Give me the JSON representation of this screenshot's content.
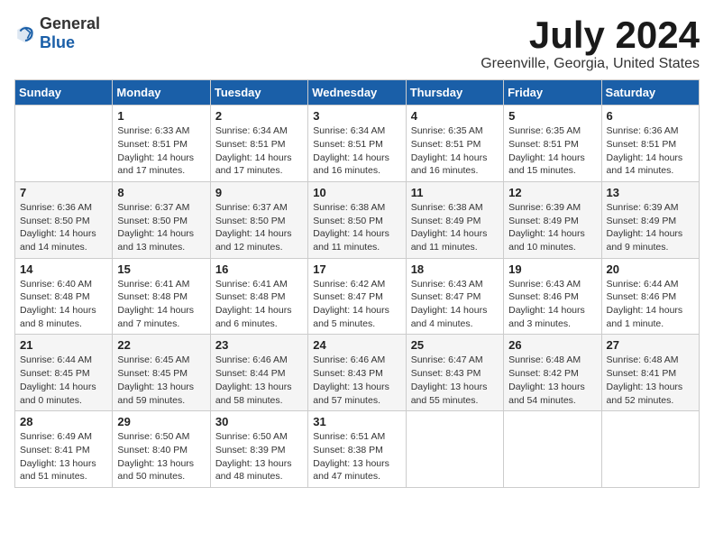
{
  "header": {
    "logo_general": "General",
    "logo_blue": "Blue",
    "month_title": "July 2024",
    "location": "Greenville, Georgia, United States"
  },
  "weekdays": [
    "Sunday",
    "Monday",
    "Tuesday",
    "Wednesday",
    "Thursday",
    "Friday",
    "Saturday"
  ],
  "weeks": [
    [
      {
        "day": "",
        "info": ""
      },
      {
        "day": "1",
        "info": "Sunrise: 6:33 AM\nSunset: 8:51 PM\nDaylight: 14 hours\nand 17 minutes."
      },
      {
        "day": "2",
        "info": "Sunrise: 6:34 AM\nSunset: 8:51 PM\nDaylight: 14 hours\nand 17 minutes."
      },
      {
        "day": "3",
        "info": "Sunrise: 6:34 AM\nSunset: 8:51 PM\nDaylight: 14 hours\nand 16 minutes."
      },
      {
        "day": "4",
        "info": "Sunrise: 6:35 AM\nSunset: 8:51 PM\nDaylight: 14 hours\nand 16 minutes."
      },
      {
        "day": "5",
        "info": "Sunrise: 6:35 AM\nSunset: 8:51 PM\nDaylight: 14 hours\nand 15 minutes."
      },
      {
        "day": "6",
        "info": "Sunrise: 6:36 AM\nSunset: 8:51 PM\nDaylight: 14 hours\nand 14 minutes."
      }
    ],
    [
      {
        "day": "7",
        "info": "Sunrise: 6:36 AM\nSunset: 8:50 PM\nDaylight: 14 hours\nand 14 minutes."
      },
      {
        "day": "8",
        "info": "Sunrise: 6:37 AM\nSunset: 8:50 PM\nDaylight: 14 hours\nand 13 minutes."
      },
      {
        "day": "9",
        "info": "Sunrise: 6:37 AM\nSunset: 8:50 PM\nDaylight: 14 hours\nand 12 minutes."
      },
      {
        "day": "10",
        "info": "Sunrise: 6:38 AM\nSunset: 8:50 PM\nDaylight: 14 hours\nand 11 minutes."
      },
      {
        "day": "11",
        "info": "Sunrise: 6:38 AM\nSunset: 8:49 PM\nDaylight: 14 hours\nand 11 minutes."
      },
      {
        "day": "12",
        "info": "Sunrise: 6:39 AM\nSunset: 8:49 PM\nDaylight: 14 hours\nand 10 minutes."
      },
      {
        "day": "13",
        "info": "Sunrise: 6:39 AM\nSunset: 8:49 PM\nDaylight: 14 hours\nand 9 minutes."
      }
    ],
    [
      {
        "day": "14",
        "info": "Sunrise: 6:40 AM\nSunset: 8:48 PM\nDaylight: 14 hours\nand 8 minutes."
      },
      {
        "day": "15",
        "info": "Sunrise: 6:41 AM\nSunset: 8:48 PM\nDaylight: 14 hours\nand 7 minutes."
      },
      {
        "day": "16",
        "info": "Sunrise: 6:41 AM\nSunset: 8:48 PM\nDaylight: 14 hours\nand 6 minutes."
      },
      {
        "day": "17",
        "info": "Sunrise: 6:42 AM\nSunset: 8:47 PM\nDaylight: 14 hours\nand 5 minutes."
      },
      {
        "day": "18",
        "info": "Sunrise: 6:43 AM\nSunset: 8:47 PM\nDaylight: 14 hours\nand 4 minutes."
      },
      {
        "day": "19",
        "info": "Sunrise: 6:43 AM\nSunset: 8:46 PM\nDaylight: 14 hours\nand 3 minutes."
      },
      {
        "day": "20",
        "info": "Sunrise: 6:44 AM\nSunset: 8:46 PM\nDaylight: 14 hours\nand 1 minute."
      }
    ],
    [
      {
        "day": "21",
        "info": "Sunrise: 6:44 AM\nSunset: 8:45 PM\nDaylight: 14 hours\nand 0 minutes."
      },
      {
        "day": "22",
        "info": "Sunrise: 6:45 AM\nSunset: 8:45 PM\nDaylight: 13 hours\nand 59 minutes."
      },
      {
        "day": "23",
        "info": "Sunrise: 6:46 AM\nSunset: 8:44 PM\nDaylight: 13 hours\nand 58 minutes."
      },
      {
        "day": "24",
        "info": "Sunrise: 6:46 AM\nSunset: 8:43 PM\nDaylight: 13 hours\nand 57 minutes."
      },
      {
        "day": "25",
        "info": "Sunrise: 6:47 AM\nSunset: 8:43 PM\nDaylight: 13 hours\nand 55 minutes."
      },
      {
        "day": "26",
        "info": "Sunrise: 6:48 AM\nSunset: 8:42 PM\nDaylight: 13 hours\nand 54 minutes."
      },
      {
        "day": "27",
        "info": "Sunrise: 6:48 AM\nSunset: 8:41 PM\nDaylight: 13 hours\nand 52 minutes."
      }
    ],
    [
      {
        "day": "28",
        "info": "Sunrise: 6:49 AM\nSunset: 8:41 PM\nDaylight: 13 hours\nand 51 minutes."
      },
      {
        "day": "29",
        "info": "Sunrise: 6:50 AM\nSunset: 8:40 PM\nDaylight: 13 hours\nand 50 minutes."
      },
      {
        "day": "30",
        "info": "Sunrise: 6:50 AM\nSunset: 8:39 PM\nDaylight: 13 hours\nand 48 minutes."
      },
      {
        "day": "31",
        "info": "Sunrise: 6:51 AM\nSunset: 8:38 PM\nDaylight: 13 hours\nand 47 minutes."
      },
      {
        "day": "",
        "info": ""
      },
      {
        "day": "",
        "info": ""
      },
      {
        "day": "",
        "info": ""
      }
    ]
  ]
}
